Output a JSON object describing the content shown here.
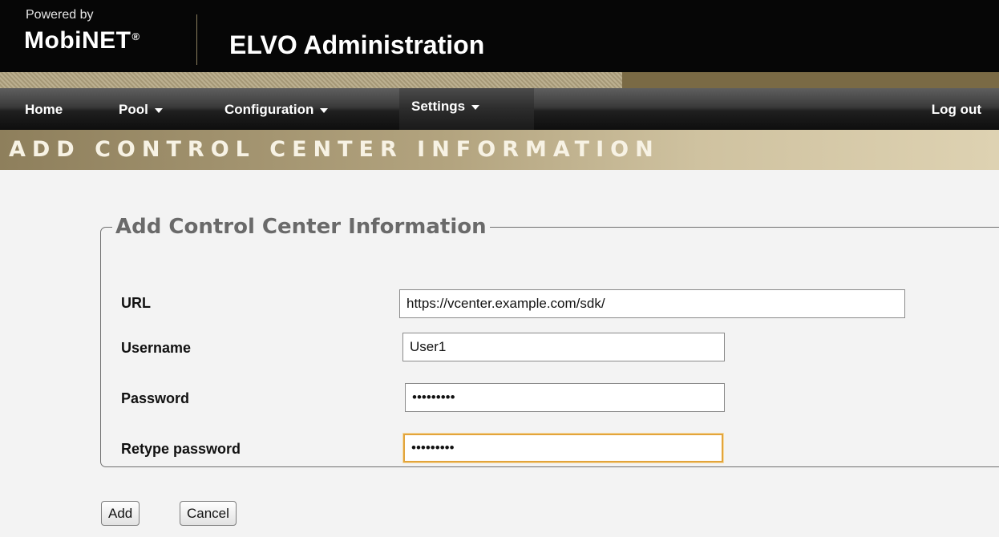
{
  "header": {
    "powered_by": "Powered by",
    "brand": "MobiNET",
    "brand_mark": "®",
    "app_title": "ELVO Administration"
  },
  "nav": {
    "items": [
      {
        "label": "Home",
        "dropdown": false
      },
      {
        "label": "Pool",
        "dropdown": true
      },
      {
        "label": "Configuration",
        "dropdown": true
      },
      {
        "label": "Settings",
        "dropdown": true
      }
    ],
    "logout": "Log out"
  },
  "banner": {
    "title": "ADD CONTROL CENTER INFORMATION"
  },
  "form": {
    "legend": "Add Control Center Information",
    "fields": [
      {
        "label": "URL",
        "value": "https://vcenter.example.com/sdk/",
        "type": "text"
      },
      {
        "label": "Username",
        "value": "User1",
        "type": "text"
      },
      {
        "label": "Password",
        "value": "•••••••••",
        "type": "password"
      },
      {
        "label": "Retype password",
        "value": "•••••••••",
        "type": "password",
        "focused": true
      }
    ],
    "buttons": {
      "add": "Add",
      "cancel": "Cancel"
    }
  },
  "colors": {
    "header_bg": "#060606",
    "banner_gold": "#b3a47f",
    "focus_outline": "#e2a43c"
  }
}
